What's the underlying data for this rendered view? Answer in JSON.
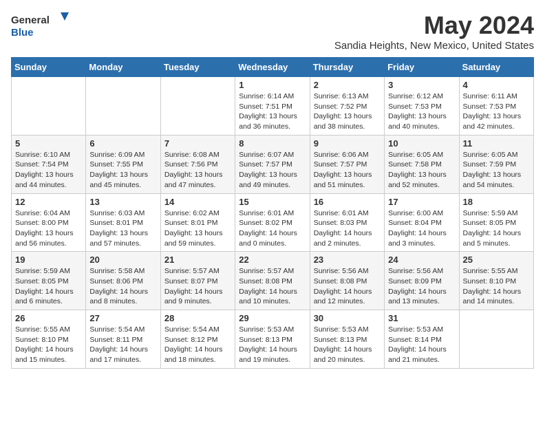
{
  "logo": {
    "general": "General",
    "blue": "Blue"
  },
  "title": "May 2024",
  "location": "Sandia Heights, New Mexico, United States",
  "days_of_week": [
    "Sunday",
    "Monday",
    "Tuesday",
    "Wednesday",
    "Thursday",
    "Friday",
    "Saturday"
  ],
  "weeks": [
    [
      {
        "day": "",
        "info": ""
      },
      {
        "day": "",
        "info": ""
      },
      {
        "day": "",
        "info": ""
      },
      {
        "day": "1",
        "info": "Sunrise: 6:14 AM\nSunset: 7:51 PM\nDaylight: 13 hours\nand 36 minutes."
      },
      {
        "day": "2",
        "info": "Sunrise: 6:13 AM\nSunset: 7:52 PM\nDaylight: 13 hours\nand 38 minutes."
      },
      {
        "day": "3",
        "info": "Sunrise: 6:12 AM\nSunset: 7:53 PM\nDaylight: 13 hours\nand 40 minutes."
      },
      {
        "day": "4",
        "info": "Sunrise: 6:11 AM\nSunset: 7:53 PM\nDaylight: 13 hours\nand 42 minutes."
      }
    ],
    [
      {
        "day": "5",
        "info": "Sunrise: 6:10 AM\nSunset: 7:54 PM\nDaylight: 13 hours\nand 44 minutes."
      },
      {
        "day": "6",
        "info": "Sunrise: 6:09 AM\nSunset: 7:55 PM\nDaylight: 13 hours\nand 45 minutes."
      },
      {
        "day": "7",
        "info": "Sunrise: 6:08 AM\nSunset: 7:56 PM\nDaylight: 13 hours\nand 47 minutes."
      },
      {
        "day": "8",
        "info": "Sunrise: 6:07 AM\nSunset: 7:57 PM\nDaylight: 13 hours\nand 49 minutes."
      },
      {
        "day": "9",
        "info": "Sunrise: 6:06 AM\nSunset: 7:57 PM\nDaylight: 13 hours\nand 51 minutes."
      },
      {
        "day": "10",
        "info": "Sunrise: 6:05 AM\nSunset: 7:58 PM\nDaylight: 13 hours\nand 52 minutes."
      },
      {
        "day": "11",
        "info": "Sunrise: 6:05 AM\nSunset: 7:59 PM\nDaylight: 13 hours\nand 54 minutes."
      }
    ],
    [
      {
        "day": "12",
        "info": "Sunrise: 6:04 AM\nSunset: 8:00 PM\nDaylight: 13 hours\nand 56 minutes."
      },
      {
        "day": "13",
        "info": "Sunrise: 6:03 AM\nSunset: 8:01 PM\nDaylight: 13 hours\nand 57 minutes."
      },
      {
        "day": "14",
        "info": "Sunrise: 6:02 AM\nSunset: 8:01 PM\nDaylight: 13 hours\nand 59 minutes."
      },
      {
        "day": "15",
        "info": "Sunrise: 6:01 AM\nSunset: 8:02 PM\nDaylight: 14 hours\nand 0 minutes."
      },
      {
        "day": "16",
        "info": "Sunrise: 6:01 AM\nSunset: 8:03 PM\nDaylight: 14 hours\nand 2 minutes."
      },
      {
        "day": "17",
        "info": "Sunrise: 6:00 AM\nSunset: 8:04 PM\nDaylight: 14 hours\nand 3 minutes."
      },
      {
        "day": "18",
        "info": "Sunrise: 5:59 AM\nSunset: 8:05 PM\nDaylight: 14 hours\nand 5 minutes."
      }
    ],
    [
      {
        "day": "19",
        "info": "Sunrise: 5:59 AM\nSunset: 8:05 PM\nDaylight: 14 hours\nand 6 minutes."
      },
      {
        "day": "20",
        "info": "Sunrise: 5:58 AM\nSunset: 8:06 PM\nDaylight: 14 hours\nand 8 minutes."
      },
      {
        "day": "21",
        "info": "Sunrise: 5:57 AM\nSunset: 8:07 PM\nDaylight: 14 hours\nand 9 minutes."
      },
      {
        "day": "22",
        "info": "Sunrise: 5:57 AM\nSunset: 8:08 PM\nDaylight: 14 hours\nand 10 minutes."
      },
      {
        "day": "23",
        "info": "Sunrise: 5:56 AM\nSunset: 8:08 PM\nDaylight: 14 hours\nand 12 minutes."
      },
      {
        "day": "24",
        "info": "Sunrise: 5:56 AM\nSunset: 8:09 PM\nDaylight: 14 hours\nand 13 minutes."
      },
      {
        "day": "25",
        "info": "Sunrise: 5:55 AM\nSunset: 8:10 PM\nDaylight: 14 hours\nand 14 minutes."
      }
    ],
    [
      {
        "day": "26",
        "info": "Sunrise: 5:55 AM\nSunset: 8:10 PM\nDaylight: 14 hours\nand 15 minutes."
      },
      {
        "day": "27",
        "info": "Sunrise: 5:54 AM\nSunset: 8:11 PM\nDaylight: 14 hours\nand 17 minutes."
      },
      {
        "day": "28",
        "info": "Sunrise: 5:54 AM\nSunset: 8:12 PM\nDaylight: 14 hours\nand 18 minutes."
      },
      {
        "day": "29",
        "info": "Sunrise: 5:53 AM\nSunset: 8:13 PM\nDaylight: 14 hours\nand 19 minutes."
      },
      {
        "day": "30",
        "info": "Sunrise: 5:53 AM\nSunset: 8:13 PM\nDaylight: 14 hours\nand 20 minutes."
      },
      {
        "day": "31",
        "info": "Sunrise: 5:53 AM\nSunset: 8:14 PM\nDaylight: 14 hours\nand 21 minutes."
      },
      {
        "day": "",
        "info": ""
      }
    ]
  ]
}
